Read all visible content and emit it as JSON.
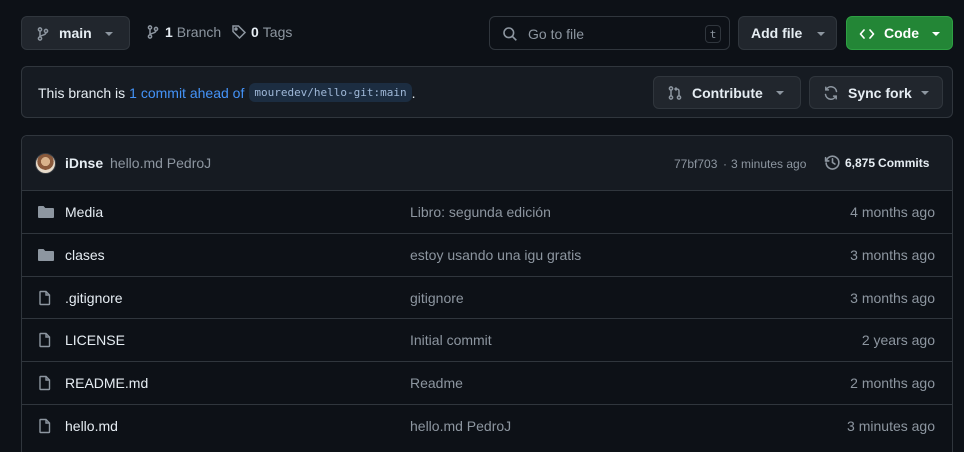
{
  "topbar": {
    "branch_name": "main",
    "branch_count": "1",
    "branch_label": "Branch",
    "tag_count": "0",
    "tag_label": "Tags",
    "search_placeholder": "Go to file",
    "search_shortcut": "t",
    "add_file_label": "Add file",
    "code_label": "Code",
    "code_color": "#238636"
  },
  "banner": {
    "prefix": "This branch is",
    "link_text": "1 commit ahead of",
    "upstream": "mouredev/hello-git:main",
    "suffix": ".",
    "contribute_label": "Contribute",
    "sync_label": "Sync fork",
    "link_color": "#4493f8"
  },
  "commit": {
    "author": "iDnse",
    "message": "hello.md PedroJ",
    "hash": "77bf703",
    "separator": "·",
    "time": "3 minutes ago",
    "commits_count": "6,875",
    "commits_label": "Commits"
  },
  "files": [
    {
      "icon": "folder-icon",
      "name": "Media",
      "message": "Libro: segunda edición",
      "age": "4 months ago"
    },
    {
      "icon": "folder-icon",
      "name": "clases",
      "message": "estoy usando una igu gratis",
      "age": "3 months ago"
    },
    {
      "icon": "file-icon",
      "name": ".gitignore",
      "message": "gitignore",
      "age": "3 months ago"
    },
    {
      "icon": "file-icon",
      "name": "LICENSE",
      "message": "Initial commit",
      "age": "2 years ago"
    },
    {
      "icon": "file-icon",
      "name": "README.md",
      "message": "Readme",
      "age": "2 months ago"
    },
    {
      "icon": "file-icon",
      "name": "hello.md",
      "message": "hello.md PedroJ",
      "age": "3 minutes ago"
    }
  ]
}
